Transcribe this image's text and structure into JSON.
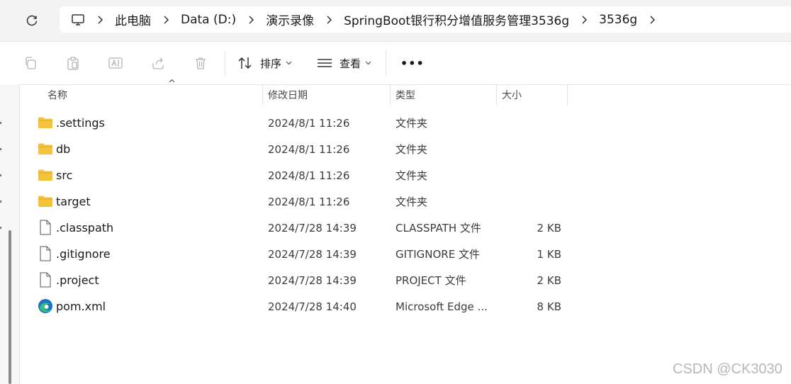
{
  "breadcrumb": [
    "此电脑",
    "Data (D:)",
    "演示录像",
    "SpringBoot银行积分增值服务管理3536g",
    "3536g"
  ],
  "toolbar": {
    "sort_label": "排序",
    "view_label": "查看",
    "more_label": "•••"
  },
  "columns": {
    "name": "名称",
    "date": "修改日期",
    "type": "类型",
    "size": "大小"
  },
  "files": [
    {
      "name": ".settings",
      "date": "2024/8/1 11:26",
      "type": "文件夹",
      "size": "",
      "icon": "folder-icon"
    },
    {
      "name": "db",
      "date": "2024/8/1 11:26",
      "type": "文件夹",
      "size": "",
      "icon": "folder-icon"
    },
    {
      "name": "src",
      "date": "2024/8/1 11:26",
      "type": "文件夹",
      "size": "",
      "icon": "folder-icon"
    },
    {
      "name": "target",
      "date": "2024/8/1 11:26",
      "type": "文件夹",
      "size": "",
      "icon": "folder-icon"
    },
    {
      "name": ".classpath",
      "date": "2024/7/28 14:39",
      "type": "CLASSPATH 文件",
      "size": "2 KB",
      "icon": "file-icon"
    },
    {
      "name": ".gitignore",
      "date": "2024/7/28 14:39",
      "type": "GITIGNORE 文件",
      "size": "1 KB",
      "icon": "file-icon"
    },
    {
      "name": ".project",
      "date": "2024/7/28 14:39",
      "type": "PROJECT 文件",
      "size": "2 KB",
      "icon": "file-icon"
    },
    {
      "name": "pom.xml",
      "date": "2024/7/28 14:40",
      "type": "Microsoft Edge ...",
      "size": "8 KB",
      "icon": "edge-icon"
    }
  ],
  "watermark": "CSDN @CK3030",
  "colors": {
    "folder": "#f5c33b",
    "folder_dark": "#e0a92a",
    "edge_blue": "#1a73c8",
    "edge_green": "#3cbf6f"
  }
}
